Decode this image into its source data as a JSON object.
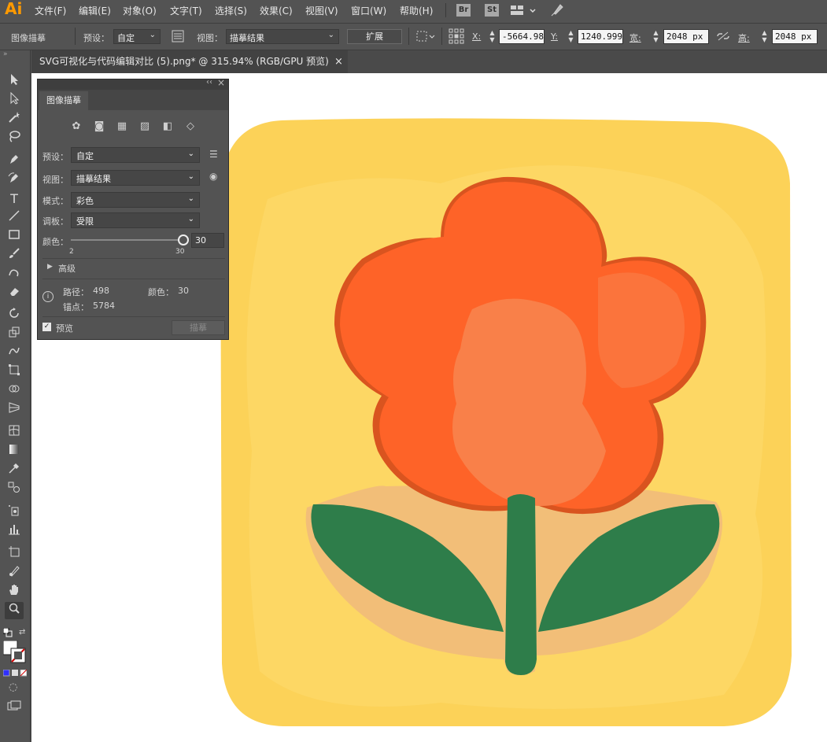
{
  "app": {
    "logo": "Ai"
  },
  "menu": [
    "文件(F)",
    "编辑(E)",
    "对象(O)",
    "文字(T)",
    "选择(S)",
    "效果(C)",
    "视图(V)",
    "窗口(W)",
    "帮助(H)"
  ],
  "menu_extras": {
    "bridge": "Br",
    "stock": "St"
  },
  "control_bar": {
    "panel_name": "图像描摹",
    "preset_label": "预设：",
    "preset_value": "自定",
    "view_label": "视图：",
    "view_value": "描摹结果",
    "expand_button": "扩展",
    "x_label": "X:",
    "x_value": "-5664.981",
    "y_label": "Y:",
    "y_value": "1240.999",
    "width_label": "宽:",
    "width_value": "2048 px",
    "height_label": "高:",
    "height_value": "2048 px"
  },
  "document_tab": {
    "title": "SVG可视化与代码编辑对比 (5).png* @ 315.94% (RGB/GPU 预览)",
    "close": "×"
  },
  "panel": {
    "title": "图像描摹",
    "collapse": "‹‹",
    "close": "×",
    "preset_label": "预设：",
    "preset_value": "自定",
    "view_label": "视图：",
    "view_value": "描摹结果",
    "mode_label": "模式：",
    "mode_value": "彩色",
    "palette_label": "调板：",
    "palette_value": "受限",
    "colors_label": "颜色：",
    "colors_value": "30",
    "colors_min": "2",
    "colors_max": "30",
    "colors_slider_fraction": 1.0,
    "advanced_label": "高级",
    "paths_label": "路径：",
    "paths_value": "498",
    "anchors_label": "锚点：",
    "anchors_value": "5784",
    "colors_count_label": "颜色：",
    "colors_count_value": "30",
    "preview_label": "预览",
    "preview_checked": true,
    "trace_button": "描摹"
  },
  "artwork": {
    "background_color": "#FCD258",
    "petal_color": "#FE6328",
    "petal_highlight": "#F98049",
    "stem_color": "#2E7D4A",
    "halo_color": "#F2BE78"
  },
  "icons": {
    "toolbar": [
      "selection-icon",
      "direct-selection-icon",
      "magic-wand-icon",
      "lasso-icon",
      "pen-icon",
      "curvature-icon",
      "type-icon",
      "line-icon",
      "rectangle-icon",
      "paintbrush-icon",
      "shaper-icon",
      "eraser-icon",
      "rotate-icon",
      "scale-icon",
      "warp-icon",
      "free-transform-icon",
      "shape-builder-icon",
      "perspective-icon",
      "mesh-icon",
      "gradient-icon",
      "eyedropper-icon",
      "blend-icon",
      "symbol-sprayer-icon",
      "graph-icon",
      "artboard-icon",
      "slice-icon",
      "hand-icon",
      "zoom-icon"
    ]
  }
}
